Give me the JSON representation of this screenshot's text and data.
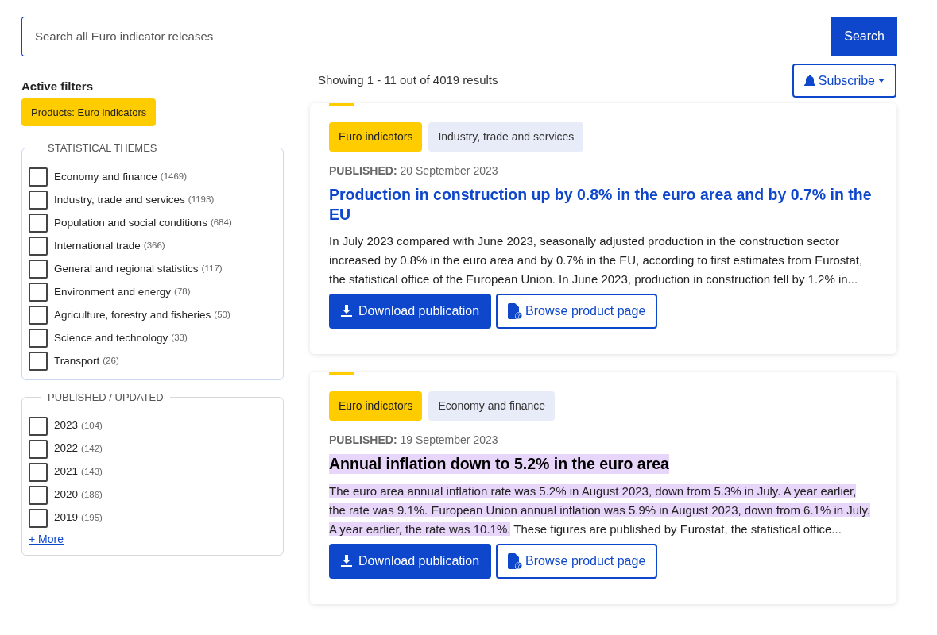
{
  "search": {
    "placeholder": "Search all Euro indicator releases",
    "button": "Search"
  },
  "active_filters": {
    "title": "Active filters",
    "chips": [
      "Products: Euro indicators"
    ]
  },
  "filter_groups": [
    {
      "title": "STATISTICAL THEMES",
      "items": [
        {
          "label": "Economy and finance",
          "count": "(1469)",
          "checked": false
        },
        {
          "label": "Industry, trade and services",
          "count": "(1193)",
          "checked": false
        },
        {
          "label": "Population and social conditions",
          "count": "(684)",
          "checked": false
        },
        {
          "label": "International trade",
          "count": "(366)",
          "checked": false
        },
        {
          "label": "General and regional statistics",
          "count": "(117)",
          "checked": false
        },
        {
          "label": "Environment and energy",
          "count": "(78)",
          "checked": false
        },
        {
          "label": "Agriculture, forestry and fisheries",
          "count": "(50)",
          "checked": false
        },
        {
          "label": "Science and technology",
          "count": "(33)",
          "checked": false
        },
        {
          "label": "Transport",
          "count": "(26)",
          "checked": false
        }
      ]
    },
    {
      "title": "PUBLISHED / UPDATED",
      "items": [
        {
          "label": "2023",
          "count": "(104)",
          "checked": false
        },
        {
          "label": "2022",
          "count": "(142)",
          "checked": false
        },
        {
          "label": "2021",
          "count": "(143)",
          "checked": false
        },
        {
          "label": "2020",
          "count": "(186)",
          "checked": false
        },
        {
          "label": "2019",
          "count": "(195)",
          "checked": false
        }
      ],
      "more": "+ More"
    }
  ],
  "results_summary": "Showing 1 - 11 out of 4019 results",
  "subscribe_button": "Subscribe",
  "results": [
    {
      "tags": [
        {
          "label": "Euro indicators",
          "kind": "product"
        },
        {
          "label": "Industry, trade and services",
          "kind": "theme"
        }
      ],
      "published_label": "PUBLISHED:",
      "published_date": "20 September 2023",
      "title": {
        "text": "Production in construction up by 0.8% in the euro area and by 0.7% in the EU",
        "highlighted": false
      },
      "description": [
        {
          "text": "In July 2023 compared with June 2023, seasonally adjusted production in the construction sector increased by 0.8% in the euro area and by 0.7% in the EU, according to first estimates from Eurostat, the statistical office of the European Union. In June 2023, production in construction fell by 1.2% in...",
          "highlighted": false
        }
      ],
      "download_button": "Download publication",
      "browse_button": "Browse product page"
    },
    {
      "tags": [
        {
          "label": "Euro indicators",
          "kind": "product"
        },
        {
          "label": "Economy and finance",
          "kind": "theme"
        }
      ],
      "published_label": "PUBLISHED:",
      "published_date": "19 September 2023",
      "title": {
        "text": "Annual inflation down to 5.2% in the euro area",
        "highlighted": true
      },
      "description": [
        {
          "text": "The euro area annual inflation rate was 5.2% in August 2023, down from 5.3% in July. A year earlier, the rate was 9.1%. European Union annual inflation was 5.9% in August 2023, down from 6.1% in July. A year earlier, the rate was 10.1%.",
          "highlighted": true
        },
        {
          "text": " These figures are published by Eurostat, the statistical office...",
          "highlighted": false
        }
      ],
      "download_button": "Download publication",
      "browse_button": "Browse product page"
    }
  ]
}
